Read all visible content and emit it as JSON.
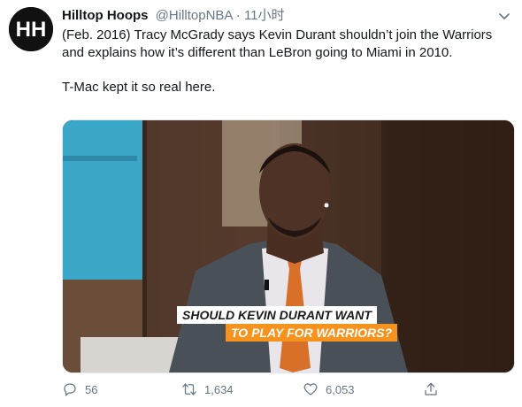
{
  "tweet": {
    "display_name": "Hilltop Hoops",
    "handle": "@HilltopNBA",
    "separator": "·",
    "time": "11小时",
    "avatar_text": "HH",
    "text_line1": "(Feb. 2016) Tracy McGrady says Kevin Durant shouldn’t join the Warriors and explains how it’s different than LeBron going to Miami in 2010.",
    "text_line2": "T-Mac kept it so real here."
  },
  "media": {
    "caption_line1": "SHOULD KEVIN DURANT WANT",
    "caption_line2": "TO PLAY FOR WARRIORS?"
  },
  "actions": {
    "replies": "56",
    "retweets": "1,634",
    "likes": "6,053"
  },
  "colors": {
    "text": "#14171a",
    "secondary": "#657786",
    "caption_orange": "#f6921e"
  },
  "icons": [
    "chevron-down-icon",
    "reply-icon",
    "retweet-icon",
    "like-icon",
    "share-icon"
  ]
}
